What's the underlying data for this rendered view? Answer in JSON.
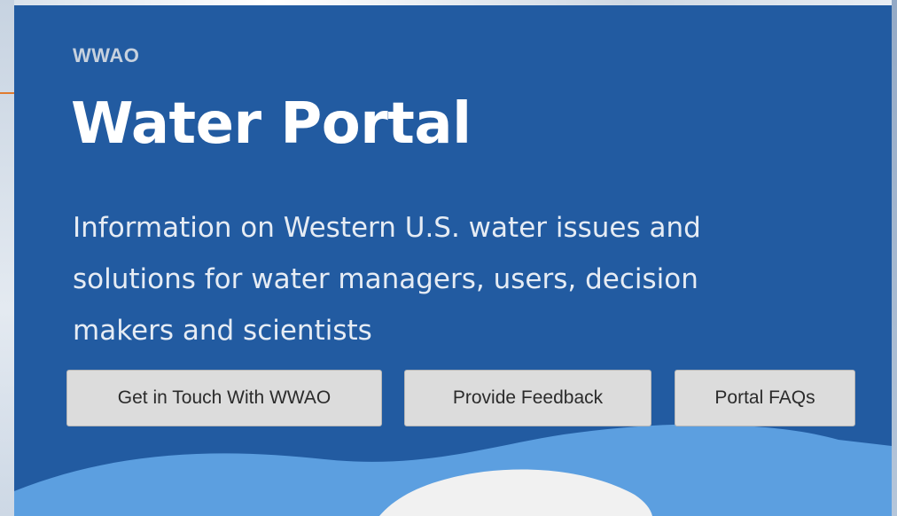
{
  "hero": {
    "eyebrow": "WWAO",
    "title": "Water Portal",
    "subtitle_lines": [
      "Information on Western U.S. water issues and",
      "solutions for water managers, users, decision",
      "makers and scientists"
    ]
  },
  "buttons": {
    "contact": "Get in Touch With WWAO",
    "feedback": "Provide Feedback",
    "faqs": "Portal FAQs"
  },
  "colors": {
    "hero_background": "#225ba1",
    "wave_light_blue": "#5c9fe0",
    "wave_white": "#f1f1f1",
    "button_background": "#dcdcdc",
    "accent_orange": "#e07b2f"
  }
}
